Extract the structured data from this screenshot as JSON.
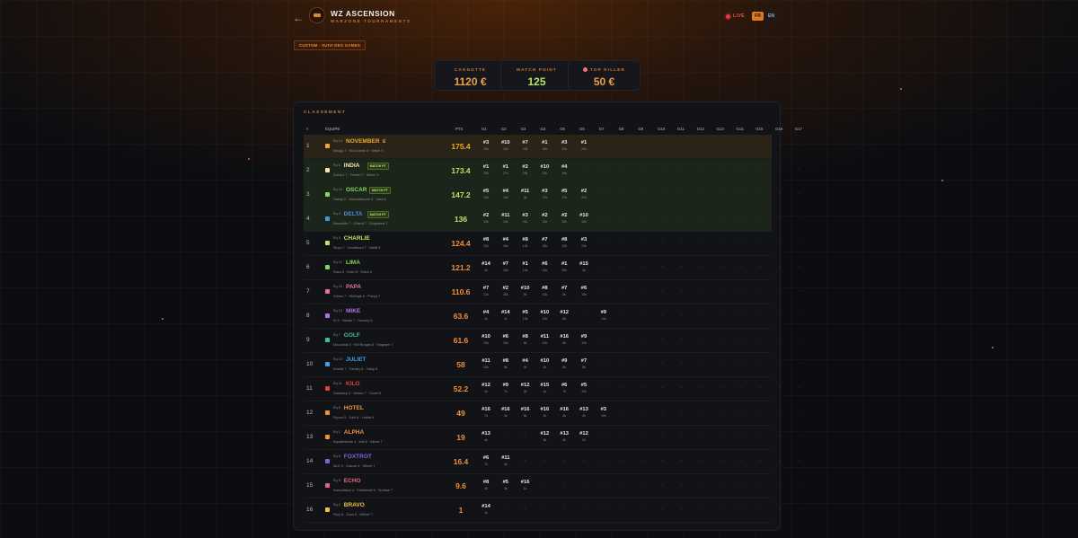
{
  "header": {
    "back_icon": "arrow-left-icon",
    "title": "WZ ASCENSION",
    "subtitle": "WARZONE TOURNAMENTS",
    "live_label": "LIVE",
    "lang_fr": "FR",
    "lang_en": "EN"
  },
  "mode_tag": "CUSTOM - SUIVI DES GAMES",
  "stats": {
    "cagnotte_label": "CAGNOTTE",
    "cagnotte_value": "1120 €",
    "match_point_label": "MATCH POINT",
    "match_point_value": "125",
    "top_killer_label": "TOP KILLER",
    "top_killer_value": "50 €"
  },
  "table": {
    "title": "CLASSEMENT",
    "col_rank": "#",
    "col_team": "ÉQUIPE",
    "col_pts": "PTS",
    "game_headers": [
      "G1",
      "G2",
      "G3",
      "G4",
      "G5",
      "G6",
      "G7",
      "G8",
      "G9",
      "G10",
      "G11",
      "G12",
      "G13",
      "G14",
      "G15",
      "G16",
      "G17"
    ],
    "match_pt_badge": "MATCH PT",
    "dash": "-",
    "rows": [
      {
        "rank": "1",
        "eq": "Éq 14",
        "name": "NOVEMBER",
        "color": "#f0a830",
        "ptsColor": "#f0a830",
        "players": "Moujja 7 · KM Avanto 8 · Eeluh 9",
        "pts": "175.4",
        "crown": true,
        "badge": false,
        "highlight": "top1",
        "games": [
          [
            "#3",
            "15k"
          ],
          [
            "#10",
            "12k"
          ],
          [
            "#7",
            "20k"
          ],
          [
            "#1",
            "24k"
          ],
          [
            "#3",
            "21k"
          ],
          [
            "#1",
            "20k"
          ]
        ]
      },
      {
        "rank": "2",
        "eq": "Éq 6",
        "name": "INDIA",
        "color": "#f3e6b0",
        "ptsColor": "#b8e36a",
        "players": "Zuesk1 7 · Fedtsh 7 · Mizen 9",
        "pts": "173.4",
        "crown": false,
        "badge": true,
        "highlight": "top",
        "games": [
          [
            "#1",
            "29k"
          ],
          [
            "#1",
            "27k"
          ],
          [
            "#2",
            "29k"
          ],
          [
            "#10",
            "15k"
          ],
          [
            "#4",
            "19k"
          ]
        ]
      },
      {
        "rank": "3",
        "eq": "Éq 15",
        "name": "OSCAR",
        "color": "#7fd860",
        "ptsColor": "#b8e36a",
        "players": "Harlay 9 · Marcelltoncho 8 · Zara 8",
        "pts": "147.2",
        "crown": false,
        "badge": true,
        "highlight": "top",
        "games": [
          [
            "#5",
            "24k"
          ],
          [
            "#4",
            "16k"
          ],
          [
            "#11",
            "3k"
          ],
          [
            "#3",
            "27k"
          ],
          [
            "#5",
            "17k"
          ],
          [
            "#2",
            "22k"
          ]
        ]
      },
      {
        "rank": "4",
        "eq": "Éq 4",
        "name": "DELTA",
        "color": "#4a90e0",
        "ptsColor": "#b8e36a",
        "players": "Mussallie 7 · Grland 7 · Ekaydena 7",
        "pts": "136",
        "crown": false,
        "badge": true,
        "highlight": "top",
        "games": [
          [
            "#2",
            "15k"
          ],
          [
            "#11",
            "10k"
          ],
          [
            "#3",
            "11k"
          ],
          [
            "#2",
            "14k"
          ],
          [
            "#2",
            "20k"
          ],
          [
            "#10",
            "10k"
          ]
        ]
      },
      {
        "rank": "5",
        "eq": "Éq 3",
        "name": "CHARLIE",
        "color": "#c0e060",
        "ptsColor": "#f0903a",
        "players": "Sinyo 7 · Noobthout 7 · Wafili 9",
        "pts": "124.4",
        "crown": false,
        "badge": false,
        "highlight": "",
        "games": [
          [
            "#8",
            "12k"
          ],
          [
            "#4",
            "16k"
          ],
          [
            "#8",
            "12k"
          ],
          [
            "#7",
            "15k"
          ],
          [
            "#8",
            "12k"
          ],
          [
            "#3",
            "23k"
          ]
        ]
      },
      {
        "rank": "6",
        "eq": "Éq 12",
        "name": "LIMA",
        "color": "#7fd860",
        "ptsColor": "#f0903a",
        "players": "Raze 6 · Eslin 8 · Soleo 6",
        "pts": "121.2",
        "crown": false,
        "badge": false,
        "highlight": "",
        "games": [
          [
            "#14",
            "2k"
          ],
          [
            "#7",
            "10k"
          ],
          [
            "#1",
            "14k"
          ],
          [
            "#6",
            "14k"
          ],
          [
            "#1",
            "29k"
          ],
          [
            "#15",
            "3k"
          ]
        ]
      },
      {
        "rank": "7",
        "eq": "Éq 16",
        "name": "PAPA",
        "color": "#e870a0",
        "ptsColor": "#f0903a",
        "players": "Vdoen 7 · Strdngth 6 · Prizya 7",
        "pts": "110.6",
        "crown": false,
        "badge": false,
        "highlight": "",
        "games": [
          [
            "#7",
            "21k"
          ],
          [
            "#2",
            "25k"
          ],
          [
            "#10",
            "9k"
          ],
          [
            "#8",
            "16k"
          ],
          [
            "#7",
            "8k"
          ],
          [
            "#6",
            "16k"
          ]
        ]
      },
      {
        "rank": "8",
        "eq": "Éq 13",
        "name": "MIKE",
        "color": "#b070e8",
        "ptsColor": "#f0903a",
        "players": "Kl 3 · Hbeak 7 · Dominy 6",
        "pts": "63.6",
        "crown": false,
        "badge": false,
        "highlight": "",
        "games": [
          [
            "#4",
            "4k"
          ],
          [
            "#14",
            "2k"
          ],
          [
            "#5",
            "10k"
          ],
          [
            "#10",
            "10k"
          ],
          [
            "#12",
            "8k"
          ],
          [
            "-",
            ""
          ],
          [
            "#9",
            "14k"
          ]
        ]
      },
      {
        "rank": "9",
        "eq": "Éq 7",
        "name": "GOLF",
        "color": "#40c090",
        "ptsColor": "#f0903a",
        "players": "Mozzarlat 5 · KM Brogan 8 · Magnum 7",
        "pts": "61.6",
        "crown": false,
        "badge": false,
        "highlight": "",
        "games": [
          [
            "#10",
            "10k"
          ],
          [
            "#6",
            "10k"
          ],
          [
            "#8",
            "8k"
          ],
          [
            "#11",
            "10k"
          ],
          [
            "#16",
            "3k"
          ],
          [
            "#9",
            "10k"
          ]
        ]
      },
      {
        "rank": "10",
        "eq": "Éq 10",
        "name": "JULIET",
        "color": "#40a0e0",
        "ptsColor": "#f0903a",
        "players": "Kbellel 7 · Farisky 6 · Yabip 8",
        "pts": "58",
        "crown": false,
        "badge": false,
        "highlight": "",
        "games": [
          [
            "#11",
            "10k"
          ],
          [
            "#8",
            "8k"
          ],
          [
            "#4",
            "4k"
          ],
          [
            "#10",
            "4k"
          ],
          [
            "#9",
            "8k"
          ],
          [
            "#7",
            "8k"
          ]
        ]
      },
      {
        "rank": "11",
        "eq": "Éq 11",
        "name": "KILO",
        "color": "#e04040",
        "ptsColor": "#f0903a",
        "players": "Dasweep 3 · Nedao 7 · Doshi 8",
        "pts": "52.2",
        "crown": false,
        "badge": false,
        "highlight": "",
        "games": [
          [
            "#12",
            "2k"
          ],
          [
            "#9",
            "7k"
          ],
          [
            "#12",
            "2k"
          ],
          [
            "#15",
            "1k"
          ],
          [
            "#6",
            "7k"
          ],
          [
            "#5",
            "10k"
          ]
        ]
      },
      {
        "rank": "12",
        "eq": "Éq 8",
        "name": "HOTEL",
        "color": "#f0903a",
        "ptsColor": "#f0903a",
        "players": "Flyvso 5 · Juliz 6 · Lethal 6",
        "pts": "49",
        "crown": false,
        "badge": false,
        "highlight": "",
        "games": [
          [
            "#16",
            "7k"
          ],
          [
            "#16",
            "4k"
          ],
          [
            "#16",
            "8k"
          ],
          [
            "#16",
            "4k"
          ],
          [
            "#16",
            "6k"
          ],
          [
            "#13",
            "4k"
          ],
          [
            "#3",
            "10k"
          ]
        ]
      },
      {
        "rank": "13",
        "eq": "Éq 1",
        "name": "ALPHA",
        "color": "#f0903a",
        "ptsColor": "#f0903a",
        "players": "Aquafleleurie 4 · Adil 6 · Alexis 7",
        "pts": "19",
        "crown": false,
        "badge": false,
        "highlight": "",
        "games": [
          [
            "#13",
            "4k"
          ],
          [
            "-",
            ""
          ],
          [
            "-",
            ""
          ],
          [
            "#12",
            "3k"
          ],
          [
            "#13",
            "3k"
          ],
          [
            "#12",
            "2k"
          ]
        ]
      },
      {
        "rank": "14",
        "eq": "Éq 6",
        "name": "FOXTROT",
        "color": "#8060e0",
        "ptsColor": "#f0903a",
        "players": "MLK 3 · Kranze 4 · Mbeni 7",
        "pts": "16.4",
        "crown": false,
        "badge": false,
        "highlight": "",
        "games": [
          [
            "#6",
            "7k"
          ],
          [
            "#11",
            "3k"
          ]
        ]
      },
      {
        "rank": "15",
        "eq": "Éq 5",
        "name": "ECHO",
        "color": "#e86080",
        "ptsColor": "#f0903a",
        "players": "Kalounitsou 4 · Eddiebeat 5 · Sunbae 7",
        "pts": "9.6",
        "crown": false,
        "badge": false,
        "highlight": "",
        "games": [
          [
            "#8",
            "4k"
          ],
          [
            "#5",
            "3k"
          ],
          [
            "#16",
            "1k"
          ]
        ]
      },
      {
        "rank": "16",
        "eq": "Éq 2",
        "name": "BRAVO",
        "color": "#f0c040",
        "ptsColor": "#f0903a",
        "players": "Flizy 8 · Zozo 5 · M0ha7 7",
        "pts": "1",
        "crown": false,
        "badge": false,
        "highlight": "",
        "games": [
          [
            "#14",
            "1k"
          ]
        ]
      }
    ]
  }
}
